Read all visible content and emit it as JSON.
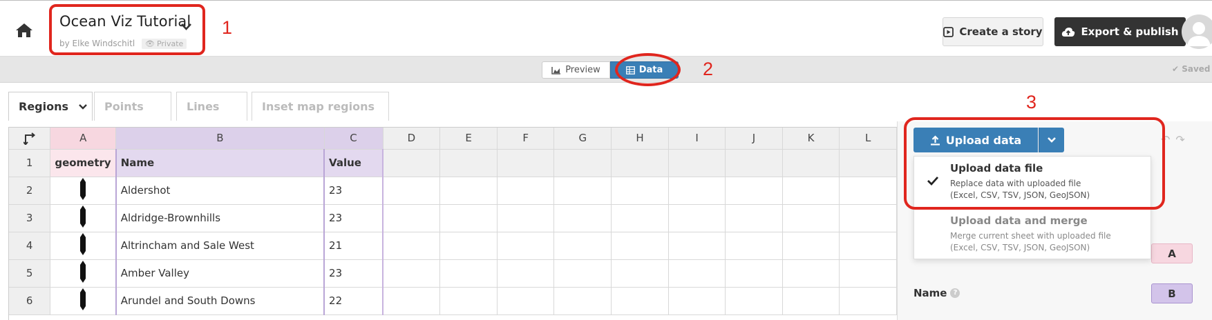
{
  "header": {
    "title": "Ocean Viz Tutorial",
    "author": "by Elke Windschitl",
    "privacy_badge": "Private",
    "create_story_label": "Create a story",
    "export_label": "Export & publish"
  },
  "modebar": {
    "preview_label": "Preview",
    "data_label": "Data",
    "saved_label": "Saved"
  },
  "tabs": [
    {
      "label": "Regions",
      "active": true
    },
    {
      "label": "Points",
      "active": false
    },
    {
      "label": "Lines",
      "active": false
    },
    {
      "label": "Inset map regions",
      "active": false
    }
  ],
  "grid": {
    "columns": [
      "A",
      "B",
      "C",
      "D",
      "E",
      "F",
      "G",
      "H",
      "I",
      "J",
      "K",
      "L"
    ],
    "header_row": {
      "num": "1",
      "geometry": "geometry",
      "name": "Name",
      "value": "Value"
    },
    "rows": [
      {
        "num": "2",
        "name": "Aldershot",
        "value": "23"
      },
      {
        "num": "3",
        "name": "Aldridge-Brownhills",
        "value": "23"
      },
      {
        "num": "4",
        "name": "Altrincham and Sale West",
        "value": "21"
      },
      {
        "num": "5",
        "name": "Amber Valley",
        "value": "23"
      },
      {
        "num": "6",
        "name": "Arundel and South Downs",
        "value": "22"
      }
    ]
  },
  "upload": {
    "button_label": "Upload data",
    "menu": [
      {
        "title": "Upload data file",
        "desc1": "Replace data with uploaded file",
        "desc2": "(Excel, CSV, TSV, JSON, GeoJSON)",
        "checked": true
      },
      {
        "title": "Upload data and merge",
        "desc1": "Merge current sheet with uploaded file",
        "desc2": "(Excel, CSV, TSV, JSON, GeoJSON)",
        "checked": false
      }
    ]
  },
  "bindings_panel": {
    "name_label": "Name",
    "chip_a": "A",
    "chip_b": "B"
  },
  "annotations": [
    "1",
    "2",
    "3"
  ],
  "colors": {
    "accent": "#3a7fb6",
    "annotation_red": "#e0261e",
    "col_a": "#f7d7e0",
    "col_bc": "#dcd0ea",
    "export_bg": "#333333"
  }
}
